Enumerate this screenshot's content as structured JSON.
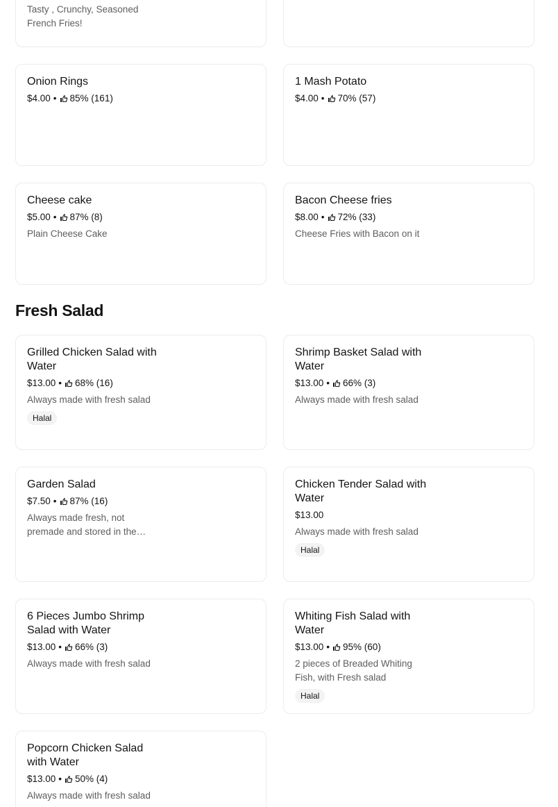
{
  "top_partial": {
    "left_desc_line1": "Tasty , Crunchy, Seasoned",
    "left_desc_line2": "French Fries!"
  },
  "sides": [
    {
      "name": "Onion Rings",
      "price": "$4.00",
      "rating": "85% (161)"
    },
    {
      "name": "1 Mash Potato",
      "price": "$4.00",
      "rating": "70% (57)"
    },
    {
      "name": "Cheese cake",
      "price": "$5.00",
      "rating": "87% (8)",
      "desc": "Plain Cheese Cake"
    },
    {
      "name": "Bacon Cheese fries",
      "price": "$8.00",
      "rating": "72% (33)",
      "desc": "Cheese Fries with Bacon on it"
    }
  ],
  "section_title": "Fresh Salad",
  "salads": [
    {
      "name": "Grilled Chicken Salad with Water",
      "price": "$13.00",
      "rating": "68% (16)",
      "desc": "Always made with fresh salad",
      "badge": "Halal"
    },
    {
      "name": "Shrimp Basket Salad with Water",
      "price": "$13.00",
      "rating": "66% (3)",
      "desc": "Always made with fresh salad"
    },
    {
      "name": "Garden Salad",
      "price": "$7.50",
      "rating": "87% (16)",
      "desc": "Always made fresh, not premade and stored in the…"
    },
    {
      "name": "Chicken Tender Salad with Water",
      "price": "$13.00",
      "desc": "Always made with fresh salad",
      "badge": "Halal"
    },
    {
      "name": "6 Pieces Jumbo Shrimp Salad with Water",
      "price": "$13.00",
      "rating": "66% (3)",
      "desc": "Always made with fresh salad"
    },
    {
      "name": "Whiting Fish Salad with Water",
      "price": "$13.00",
      "rating": "95% (60)",
      "desc": "2 pieces of Breaded Whiting Fish, with Fresh salad",
      "badge": "Halal"
    },
    {
      "name": "Popcorn Chicken Salad with Water",
      "price": "$13.00",
      "rating": "50% (4)",
      "desc": "Always made with fresh salad"
    }
  ],
  "separator": "•",
  "icons": {
    "rating": "thumbs-up-icon"
  }
}
